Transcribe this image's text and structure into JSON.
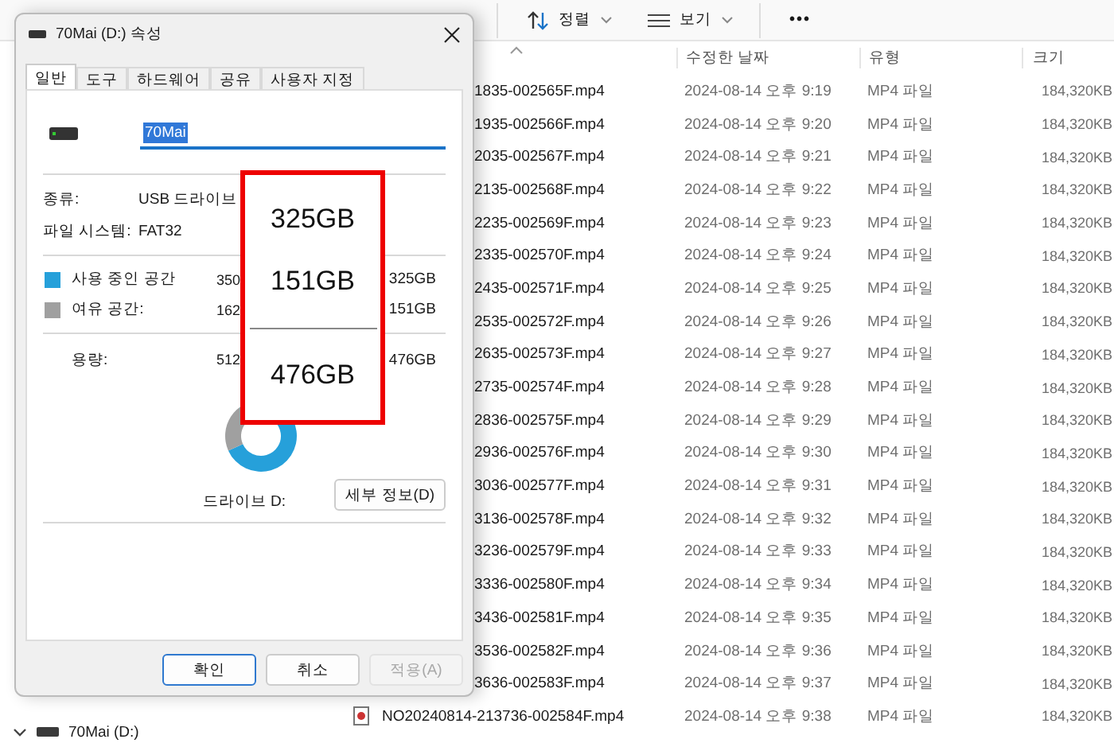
{
  "explorer": {
    "toolbar": {
      "sort": "정렬",
      "view": "보기",
      "more": "•••"
    },
    "columns": [
      {
        "label": "수정한 날짜"
      },
      {
        "label": "유형"
      },
      {
        "label": "크기"
      }
    ],
    "rows": [
      {
        "kind": "covered",
        "name": "1835-002565F.mp4",
        "date": "2024-08-14 오후 9:19",
        "type": "MP4 파일",
        "size": "184,320KB"
      },
      {
        "kind": "covered",
        "name": "1935-002566F.mp4",
        "date": "2024-08-14 오후 9:20",
        "type": "MP4 파일",
        "size": "184,320KB"
      },
      {
        "kind": "covered",
        "name": "2035-002567F.mp4",
        "date": "2024-08-14 오후 9:21",
        "type": "MP4 파일",
        "size": "184,320KB"
      },
      {
        "kind": "covered",
        "name": "2135-002568F.mp4",
        "date": "2024-08-14 오후 9:22",
        "type": "MP4 파일",
        "size": "184,320KB"
      },
      {
        "kind": "covered",
        "name": "2235-002569F.mp4",
        "date": "2024-08-14 오후 9:23",
        "type": "MP4 파일",
        "size": "184,320KB"
      },
      {
        "kind": "covered",
        "name": "2335-002570F.mp4",
        "date": "2024-08-14 오후 9:24",
        "type": "MP4 파일",
        "size": "184,320KB"
      },
      {
        "kind": "covered",
        "name": "2435-002571F.mp4",
        "date": "2024-08-14 오후 9:25",
        "type": "MP4 파일",
        "size": "184,320KB"
      },
      {
        "kind": "covered",
        "name": "2535-002572F.mp4",
        "date": "2024-08-14 오후 9:26",
        "type": "MP4 파일",
        "size": "184,320KB"
      },
      {
        "kind": "covered",
        "name": "2635-002573F.mp4",
        "date": "2024-08-14 오후 9:27",
        "type": "MP4 파일",
        "size": "184,320KB"
      },
      {
        "kind": "covered",
        "name": "2735-002574F.mp4",
        "date": "2024-08-14 오후 9:28",
        "type": "MP4 파일",
        "size": "184,320KB"
      },
      {
        "kind": "covered",
        "name": "2836-002575F.mp4",
        "date": "2024-08-14 오후 9:29",
        "type": "MP4 파일",
        "size": "184,320KB"
      },
      {
        "kind": "covered",
        "name": "2936-002576F.mp4",
        "date": "2024-08-14 오후 9:30",
        "type": "MP4 파일",
        "size": "184,320KB"
      },
      {
        "kind": "covered",
        "name": "3036-002577F.mp4",
        "date": "2024-08-14 오후 9:31",
        "type": "MP4 파일",
        "size": "184,320KB"
      },
      {
        "kind": "covered",
        "name": "3136-002578F.mp4",
        "date": "2024-08-14 오후 9:32",
        "type": "MP4 파일",
        "size": "184,320KB"
      },
      {
        "kind": "covered",
        "name": "3236-002579F.mp4",
        "date": "2024-08-14 오후 9:33",
        "type": "MP4 파일",
        "size": "184,320KB"
      },
      {
        "kind": "covered",
        "name": "3336-002580F.mp4",
        "date": "2024-08-14 오후 9:34",
        "type": "MP4 파일",
        "size": "184,320KB"
      },
      {
        "kind": "covered",
        "name": "3436-002581F.mp4",
        "date": "2024-08-14 오후 9:35",
        "type": "MP4 파일",
        "size": "184,320KB"
      },
      {
        "kind": "covered",
        "name": "3536-002582F.mp4",
        "date": "2024-08-14 오후 9:36",
        "type": "MP4 파일",
        "size": "184,320KB"
      },
      {
        "kind": "covered",
        "name": "3636-002583F.mp4",
        "date": "2024-08-14 오후 9:37",
        "type": "MP4 파일",
        "size": "184,320KB"
      },
      {
        "kind": "file",
        "name": "NO20240814-213736-002584F.mp4",
        "date": "2024-08-14 오후 9:38",
        "type": "MP4 파일",
        "size": "184,320KB"
      }
    ],
    "nav": [
      {
        "label": "70Mai (D:)",
        "expanded": true
      }
    ]
  },
  "dialog": {
    "title": "70Mai (D:) 속성",
    "tabs": [
      {
        "label": "일반",
        "selected": true
      },
      {
        "label": "도구",
        "selected": false
      },
      {
        "label": "하드웨어",
        "selected": false
      },
      {
        "label": "공유",
        "selected": false
      },
      {
        "label": "사용자 지정",
        "selected": false
      }
    ],
    "name_field": {
      "value": "70Mai",
      "selected": true
    },
    "info": [
      {
        "label": "종류:",
        "value": "USB 드라이브"
      },
      {
        "label": "파일 시스템:",
        "value": "FAT32"
      }
    ],
    "legend": [
      {
        "label": "사용 중인 공간",
        "bytes": "350",
        "size": "325GB",
        "color": "#26a0da"
      },
      {
        "label": "여유 공간:",
        "bytes": "162",
        "size": "151GB",
        "color": "#a0a0a0"
      }
    ],
    "capacity": {
      "label": "용량:",
      "bytes": "512",
      "size": "476GB"
    },
    "usage": {
      "chart_data": {
        "type": "donut",
        "values": [
          68.3,
          31.7
        ]
      }
    },
    "drive_label": "드라이브 D:",
    "details_button": "세부 정보(D)",
    "buttons": [
      {
        "label": "확인",
        "default": true,
        "disabled": false
      },
      {
        "label": "취소",
        "default": false,
        "disabled": false
      },
      {
        "label": "적용(A)",
        "default": false,
        "disabled": true
      }
    ]
  },
  "callout": {
    "values": [
      "325GB",
      "151GB",
      "476GB"
    ]
  }
}
